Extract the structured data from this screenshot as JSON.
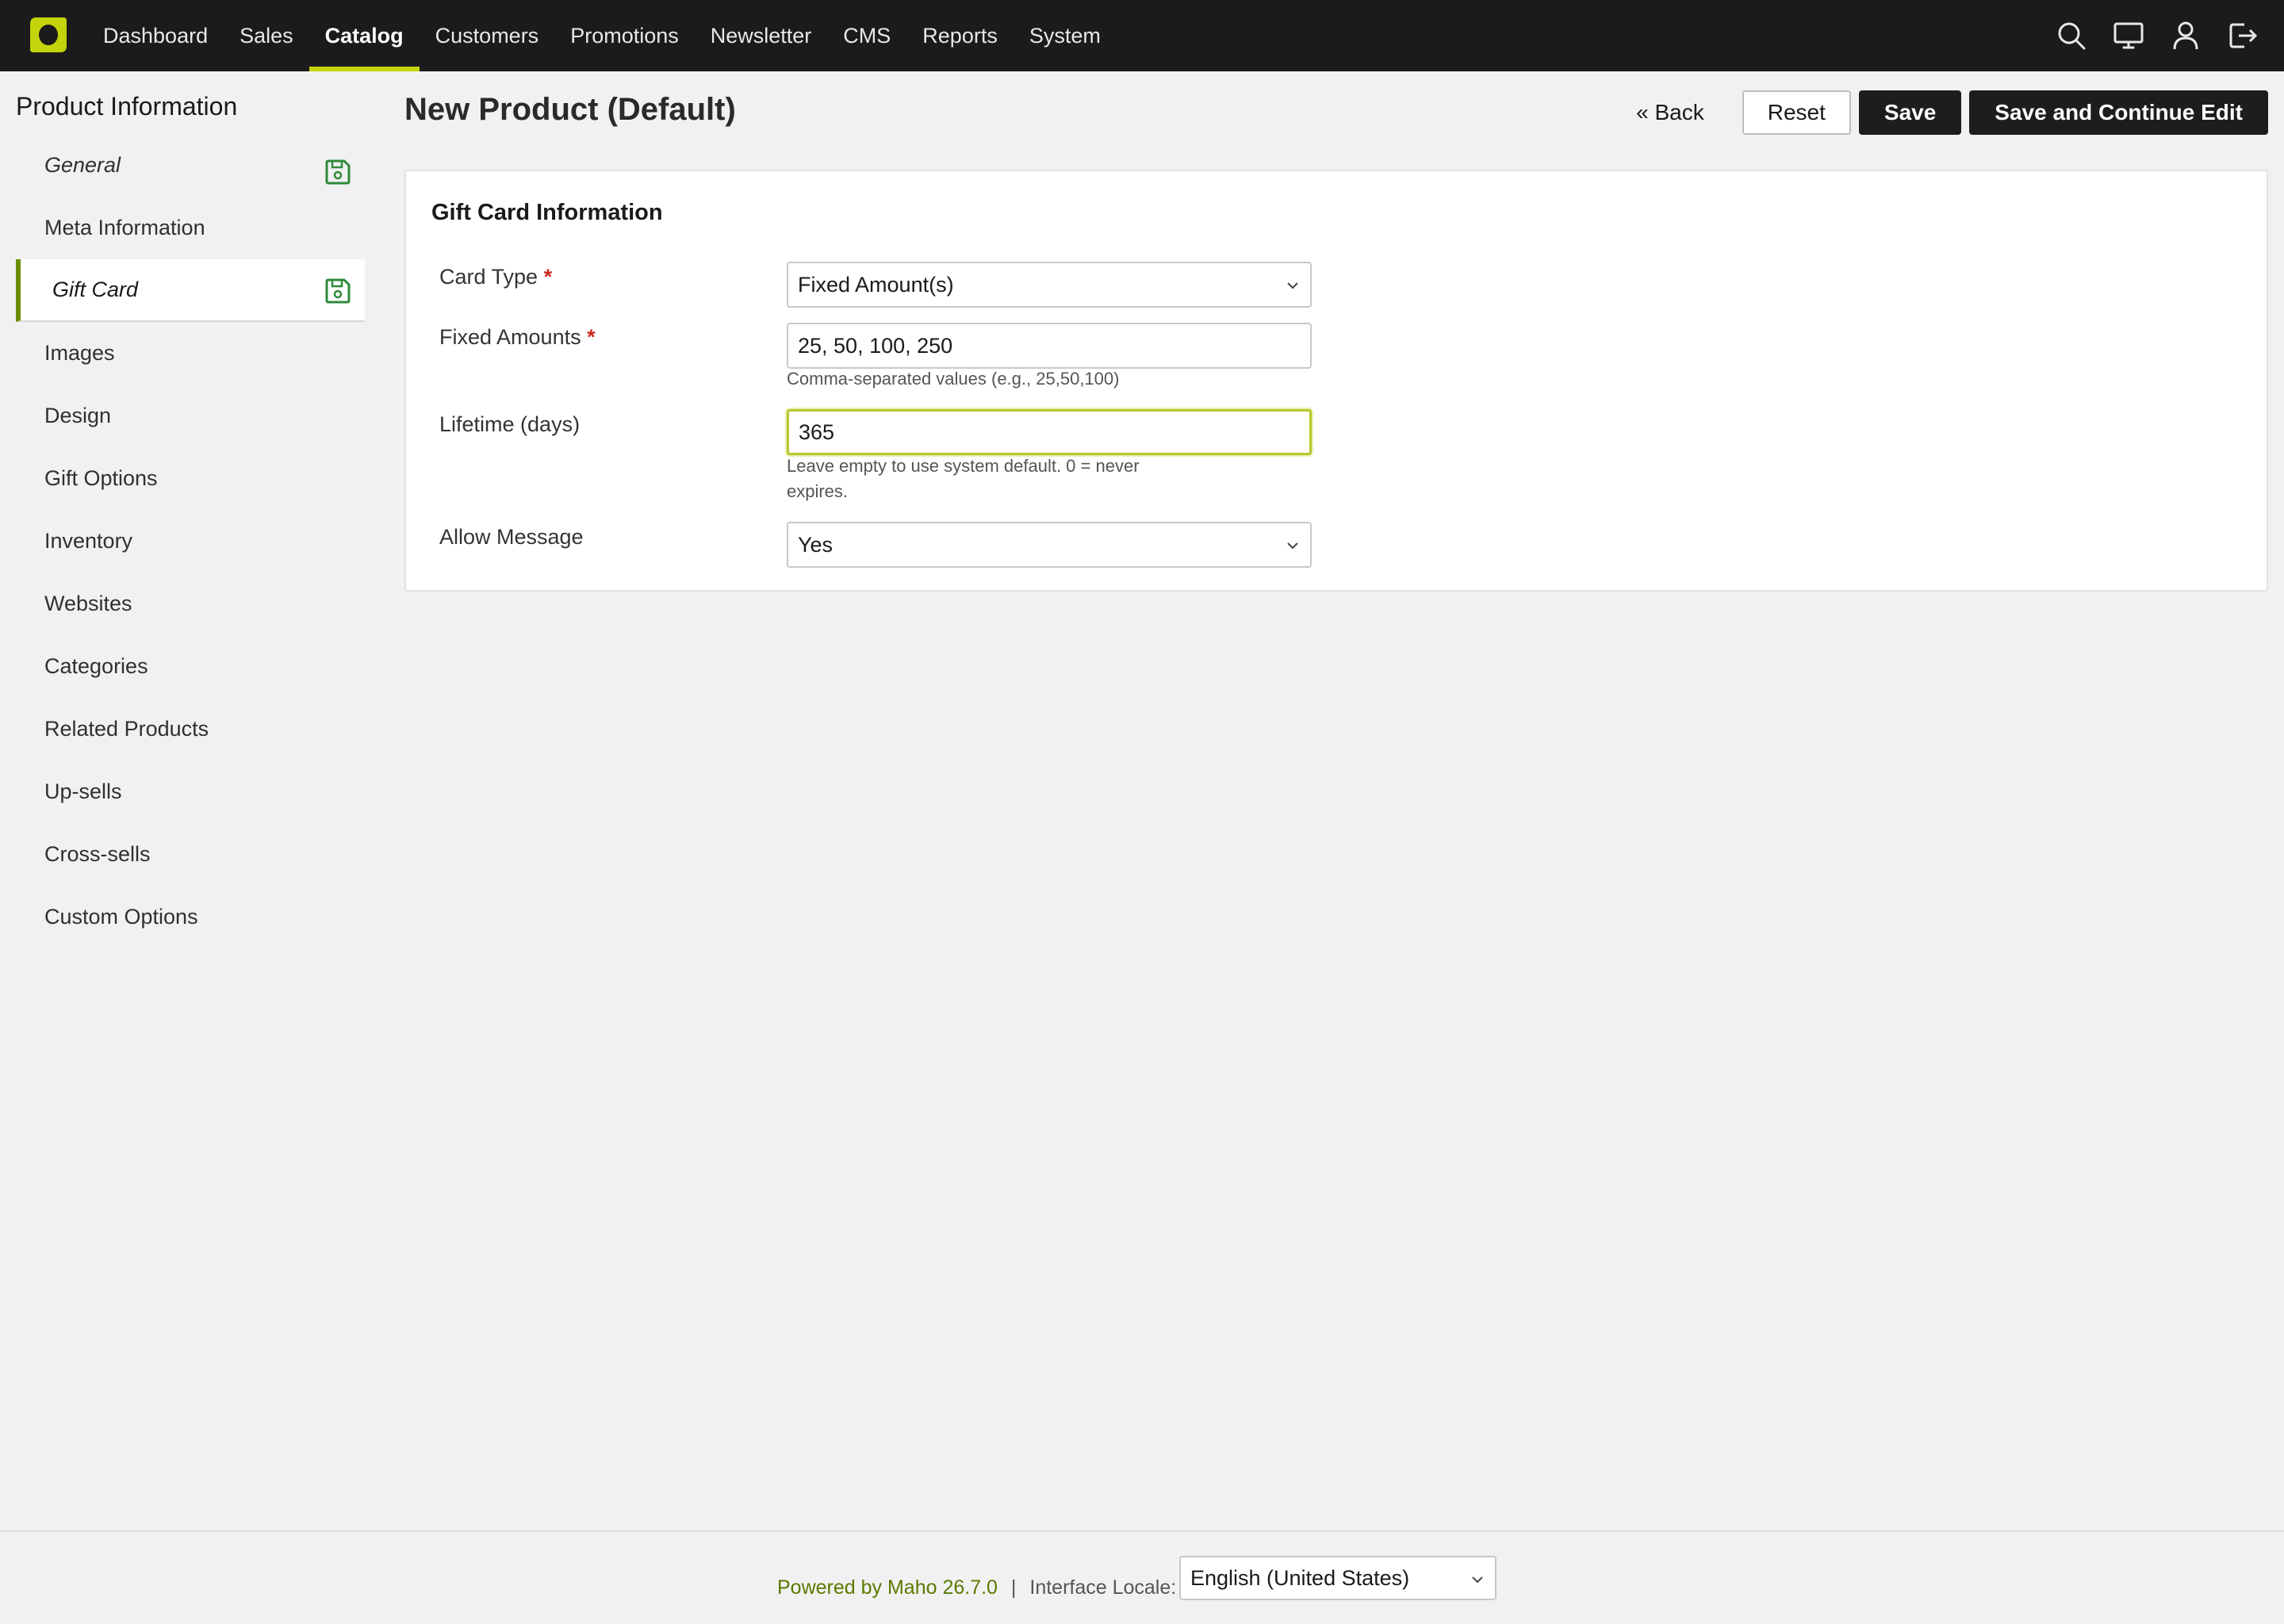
{
  "nav": {
    "items": [
      {
        "label": "Dashboard",
        "active": false
      },
      {
        "label": "Sales",
        "active": false
      },
      {
        "label": "Catalog",
        "active": true
      },
      {
        "label": "Customers",
        "active": false
      },
      {
        "label": "Promotions",
        "active": false
      },
      {
        "label": "Newsletter",
        "active": false
      },
      {
        "label": "CMS",
        "active": false
      },
      {
        "label": "Reports",
        "active": false
      },
      {
        "label": "System",
        "active": false
      }
    ],
    "icons": [
      "search-icon",
      "monitor-icon",
      "user-icon",
      "logout-icon"
    ],
    "accent_color": "#c3d50a"
  },
  "sidebar": {
    "title": "Product Information",
    "items": [
      {
        "label": "General",
        "saved": true
      },
      {
        "label": "Meta Information"
      },
      {
        "label": "Gift Card",
        "active": true,
        "saved": true
      },
      {
        "label": "Images"
      },
      {
        "label": "Design"
      },
      {
        "label": "Gift Options"
      },
      {
        "label": "Inventory"
      },
      {
        "label": "Websites"
      },
      {
        "label": "Categories"
      },
      {
        "label": "Related Products"
      },
      {
        "label": "Up-sells"
      },
      {
        "label": "Cross-sells"
      },
      {
        "label": "Custom Options"
      }
    ]
  },
  "header": {
    "title": "New Product (Default)",
    "back_label": "« Back",
    "reset_label": "Reset",
    "save_label": "Save",
    "save_continue_label": "Save and Continue Edit"
  },
  "form": {
    "section_title": "Gift Card Information",
    "card_type": {
      "label": "Card Type",
      "required_mark": "*",
      "value": "Fixed Amount(s)"
    },
    "fixed_amounts": {
      "label": "Fixed Amounts",
      "required_mark": "*",
      "value": "25, 50, 100, 250",
      "note": "Comma-separated values (e.g., 25,50,100)"
    },
    "lifetime": {
      "label": "Lifetime (days)",
      "value": "365",
      "note": "Leave empty to use system default. 0 = never expires."
    },
    "allow_message": {
      "label": "Allow Message",
      "value": "Yes"
    }
  },
  "footer": {
    "powered_by": "Powered by Maho 26.7.0",
    "separator": "|",
    "locale_label": "Interface Locale:",
    "locale_value": "English (United States)"
  }
}
